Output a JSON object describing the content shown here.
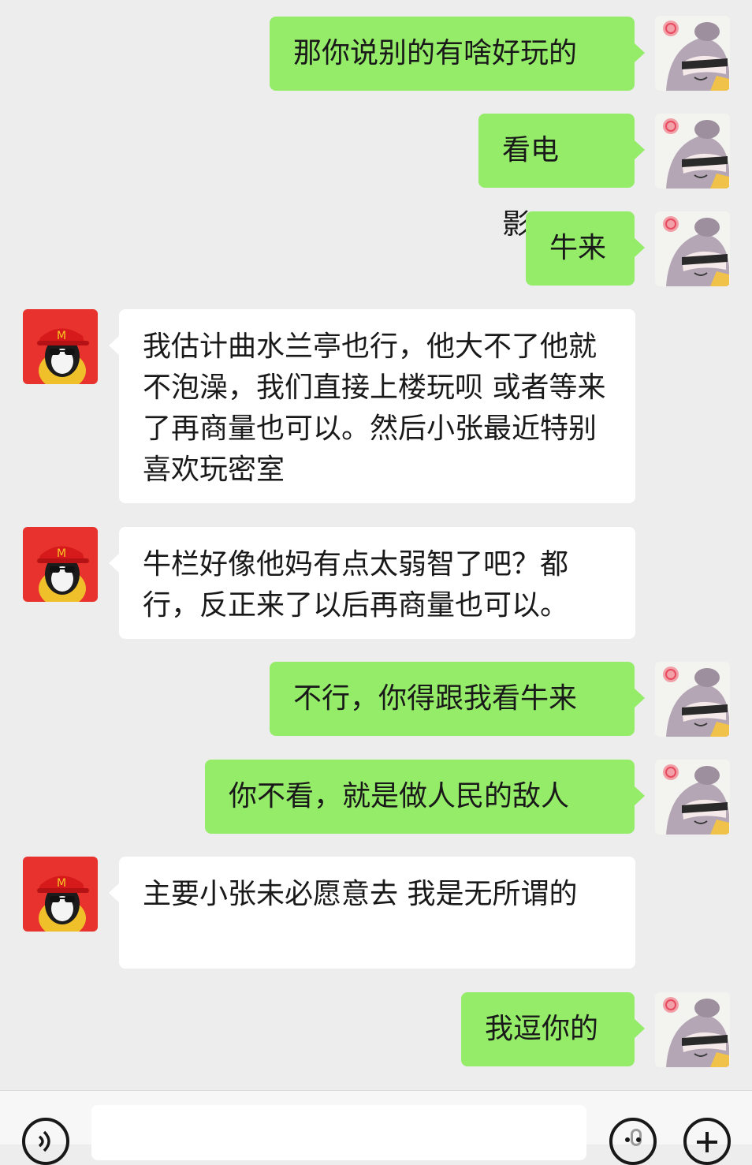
{
  "messages": [
    {
      "side": "right",
      "text": "那你说别的有啥好玩的"
    },
    {
      "side": "right",
      "text": "看电影？"
    },
    {
      "side": "right",
      "text": "牛来"
    },
    {
      "side": "left",
      "text": "我估计曲水兰亭也行，他大不了他就不泡澡，我们直接上楼玩呗 或者等来了再商量也可以。然后小张最近特别喜欢玩密室"
    },
    {
      "side": "left",
      "text": "牛栏好像他妈有点太弱智了吧？都行，反正来了以后再商量也可以。"
    },
    {
      "side": "right",
      "text": "不行，你得跟我看牛来"
    },
    {
      "side": "right",
      "text": "你不看，就是做人民的敌人"
    },
    {
      "side": "left",
      "text": "主要小张未必愿意去 我是无所谓的"
    },
    {
      "side": "right",
      "text": "我逗你的"
    }
  ],
  "colors": {
    "background": "#ededed",
    "bubble_self": "#95ec69",
    "bubble_other": "#ffffff"
  },
  "icons": {
    "voice": "voice-icon",
    "emoji": "emoji-icon",
    "plus": "plus-icon"
  }
}
